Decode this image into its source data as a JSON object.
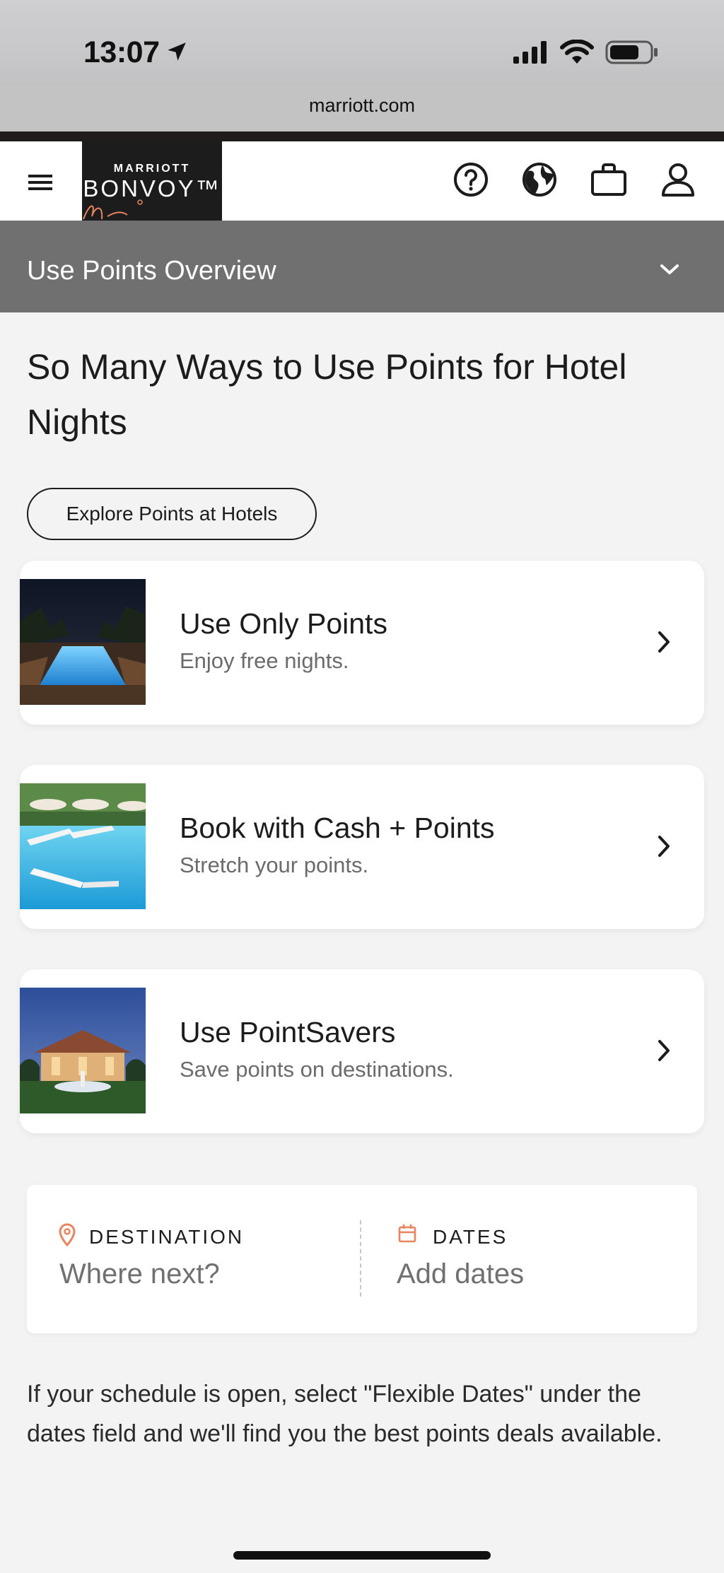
{
  "status_bar": {
    "time": "13:07"
  },
  "browser": {
    "url": "marriott.com"
  },
  "header": {
    "logo_top": "MARRIOTT",
    "logo_bottom": "BONVOY™",
    "icons": [
      "menu-icon",
      "help-icon",
      "globe-icon",
      "briefcase-icon",
      "user-icon"
    ]
  },
  "subnav": {
    "title": "Use Points Overview"
  },
  "main": {
    "heading": "So Many Ways to Use Points for Hotel Nights",
    "explore_button": "Explore Points at Hotels",
    "cards": [
      {
        "title": "Use Only Points",
        "subtitle": "Enjoy free nights."
      },
      {
        "title": "Book with Cash + Points",
        "subtitle": "Stretch your points."
      },
      {
        "title": "Use PointSavers",
        "subtitle": "Save points on destinations."
      }
    ]
  },
  "search": {
    "destination_label": "DESTINATION",
    "destination_placeholder": "Where next?",
    "dates_label": "DATES",
    "dates_placeholder": "Add dates"
  },
  "footer_text": "If your schedule is open, select \"Flexible Dates\" under the dates field and we'll find you the best points deals available.",
  "colors": {
    "accent": "#e8845f",
    "subnav_bg": "#707070",
    "logo_bg": "#1c1c1c"
  }
}
